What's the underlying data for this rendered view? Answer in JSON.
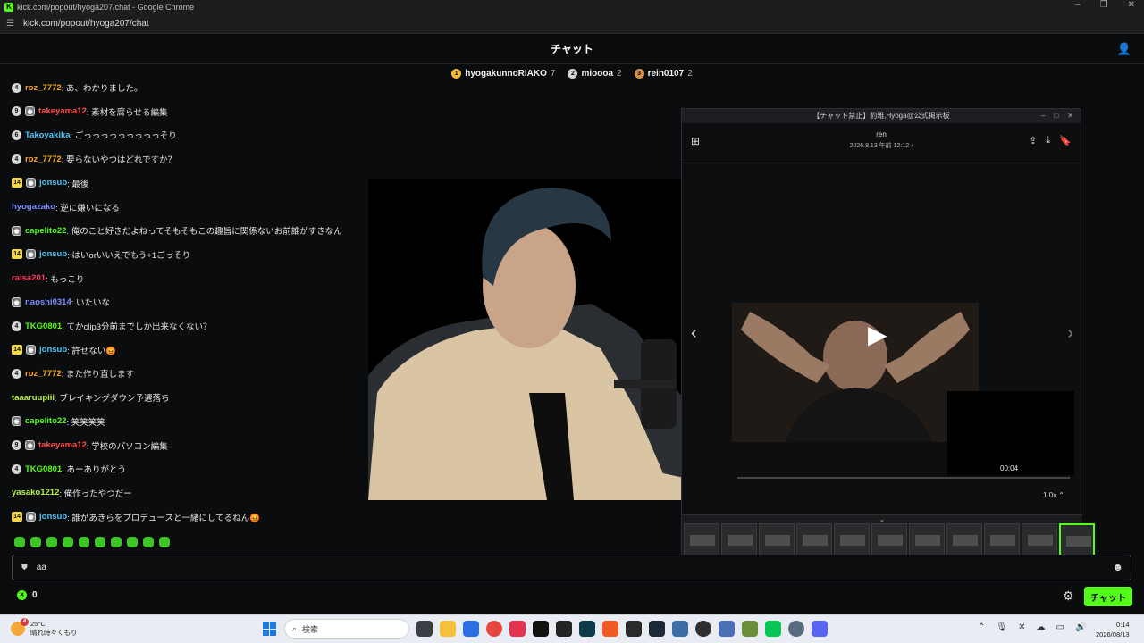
{
  "window": {
    "title": "kick.com/popout/hyoga207/chat - Google Chrome",
    "url": "kick.com/popout/hyoga207/chat"
  },
  "header": {
    "title": "チャット"
  },
  "leaderboard": [
    {
      "rank": "1",
      "name": "hyogakunnoRIAKO",
      "count": "7",
      "color": "#f2b93b"
    },
    {
      "rank": "2",
      "name": "mioooa",
      "count": "2",
      "color": "#d4d4d4"
    },
    {
      "rank": "3",
      "name": "rein0107",
      "count": "2",
      "color": "#d98f4a"
    }
  ],
  "messages": [
    {
      "badges": [
        "4"
      ],
      "user": "roz_7772",
      "color": "#f5a623",
      "text": ": あ、わかりました。"
    },
    {
      "badges": [
        "9",
        "emote"
      ],
      "user": "takeyama12",
      "color": "#ff4d4d",
      "text": ": 素材を腐らせる編集"
    },
    {
      "badges": [
        "6"
      ],
      "user": "Takoyakika",
      "color": "#4fc3f7",
      "text": ": ごっっっっっっっっっそり"
    },
    {
      "badges": [
        "4"
      ],
      "user": "roz_7772",
      "color": "#f5a623",
      "text": ": 要らないやつはどれですか？"
    },
    {
      "badges": [
        "14",
        "emote"
      ],
      "user": "jonsub",
      "color": "#4fc3f7",
      "text": ": 最後"
    },
    {
      "badges": [],
      "user": "hyogazako",
      "color": "#7b8cff",
      "text": ": 逆に嫌いになる"
    },
    {
      "badges": [
        "emote"
      ],
      "user": "capelito22",
      "color": "#53fc18",
      "text": ": 俺のこと好きだよねってそもそもこの趣旨に関係ないお前誰がすきなん"
    },
    {
      "badges": [
        "14",
        "emote"
      ],
      "user": "jonsub",
      "color": "#4fc3f7",
      "text": ": はいorいいえでもう+1ごっそり"
    },
    {
      "badges": [],
      "user": "raisa201",
      "color": "#ff3b5c",
      "text": ": もっこり"
    },
    {
      "badges": [
        "emote"
      ],
      "user": "naoshi0314",
      "color": "#7b8cff",
      "text": ": いたいな"
    },
    {
      "badges": [
        "4"
      ],
      "user": "TKG0801",
      "color": "#53fc18",
      "text": ": てかclip3分前までしか出来なくない？"
    },
    {
      "badges": [
        "14",
        "emote"
      ],
      "user": "jonsub",
      "color": "#4fc3f7",
      "text": ": 許せない😡"
    },
    {
      "badges": [
        "4"
      ],
      "user": "roz_7772",
      "color": "#f5a623",
      "text": ": また作り直します"
    },
    {
      "badges": [],
      "user": "taaaruupiii",
      "color": "#b8f04a",
      "text": ": ブレイキングダウン予選落ち"
    },
    {
      "badges": [
        "emote"
      ],
      "user": "capelito22",
      "color": "#53fc18",
      "text": ": 笑笑笑笑"
    },
    {
      "badges": [
        "9",
        "emote"
      ],
      "user": "takeyama12",
      "color": "#ff4d4d",
      "text": ": 学校のパソコン編集"
    },
    {
      "badges": [
        "4"
      ],
      "user": "TKG0801",
      "color": "#53fc18",
      "text": ": あーありがとう"
    },
    {
      "badges": [],
      "user": "yasako1212",
      "color": "#b8f04a",
      "text": ": 俺作ったやつだー"
    },
    {
      "badges": [
        "14",
        "emote"
      ],
      "user": "jonsub",
      "color": "#4fc3f7",
      "text": ": 誰があきらをプロデュースと一緒にしてるねん😡"
    }
  ],
  "popup": {
    "title": "【チャット禁止】豹雅,Hyoga@公式掲示板",
    "author": "ren",
    "date": "2026.8.13 午前 12:12 ›",
    "time": "00:04",
    "speed": "1.0x ⌃"
  },
  "input": {
    "value": "aa"
  },
  "footer": {
    "points": "0",
    "chat_button": "チャット"
  },
  "taskbar": {
    "temp": "25°C",
    "weather": "晴れ時々くもり",
    "weather_badge": "4",
    "search_placeholder": "検索",
    "time": "0:14",
    "date": "2026/08/13"
  }
}
